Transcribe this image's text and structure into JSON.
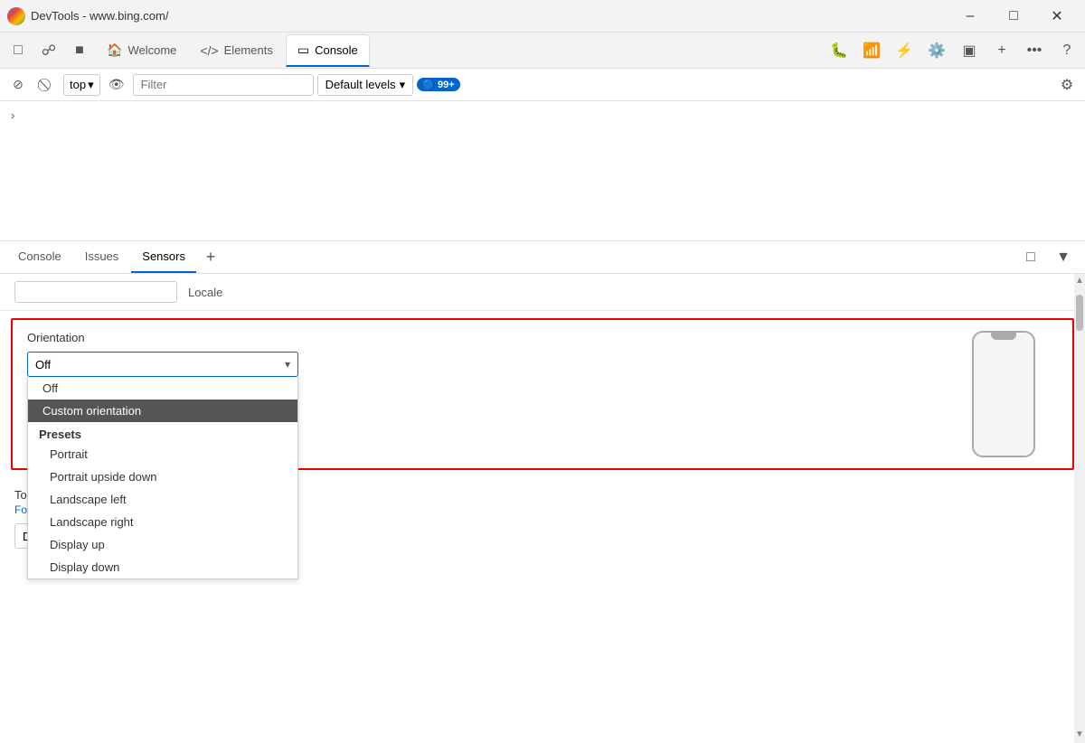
{
  "titleBar": {
    "title": "DevTools - www.bing.com/",
    "controls": [
      "minimize",
      "maximize",
      "close"
    ]
  },
  "tabs": [
    {
      "id": "welcome",
      "label": "Welcome",
      "icon": "🏠",
      "active": false
    },
    {
      "id": "elements",
      "label": "Elements",
      "icon": "</>",
      "active": false
    },
    {
      "id": "console",
      "label": "Console",
      "icon": "▣",
      "active": true
    }
  ],
  "toolbar": {
    "topSelector": "top",
    "filterPlaceholder": "Filter",
    "defaultLevels": "Default levels",
    "badgeCount": "99+",
    "badgeIcon": "🔵"
  },
  "consoleArea": {
    "chevron": "›"
  },
  "subTabs": [
    {
      "id": "console",
      "label": "Console",
      "active": false
    },
    {
      "id": "issues",
      "label": "Issues",
      "active": false
    },
    {
      "id": "sensors",
      "label": "Sensors",
      "active": true
    }
  ],
  "sensors": {
    "localeLabel": "Locale",
    "localePlaceholder": "",
    "orientationLabel": "Orientation",
    "orientationValue": "Off",
    "dropdown": {
      "items": [
        {
          "id": "off",
          "label": "Off",
          "type": "item",
          "selected": false
        },
        {
          "id": "custom",
          "label": "Custom orientation",
          "type": "item",
          "selected": true
        },
        {
          "id": "presets",
          "label": "Presets",
          "type": "group"
        },
        {
          "id": "portrait",
          "label": "Portrait",
          "type": "item-indented",
          "selected": false
        },
        {
          "id": "portrait-upside-down",
          "label": "Portrait upside down",
          "type": "item-indented",
          "selected": false
        },
        {
          "id": "landscape-left",
          "label": "Landscape left",
          "type": "item-indented",
          "selected": false
        },
        {
          "id": "landscape-right",
          "label": "Landscape right",
          "type": "item-indented",
          "selected": false
        },
        {
          "id": "display-up",
          "label": "Display up",
          "type": "item-indented",
          "selected": false
        },
        {
          "id": "display-down",
          "label": "Display down",
          "type": "item-indented",
          "selected": false
        }
      ]
    },
    "touchLabel": "Touch",
    "touchDesc": "Forces touch instead of click",
    "touchValue": "Device-based"
  }
}
